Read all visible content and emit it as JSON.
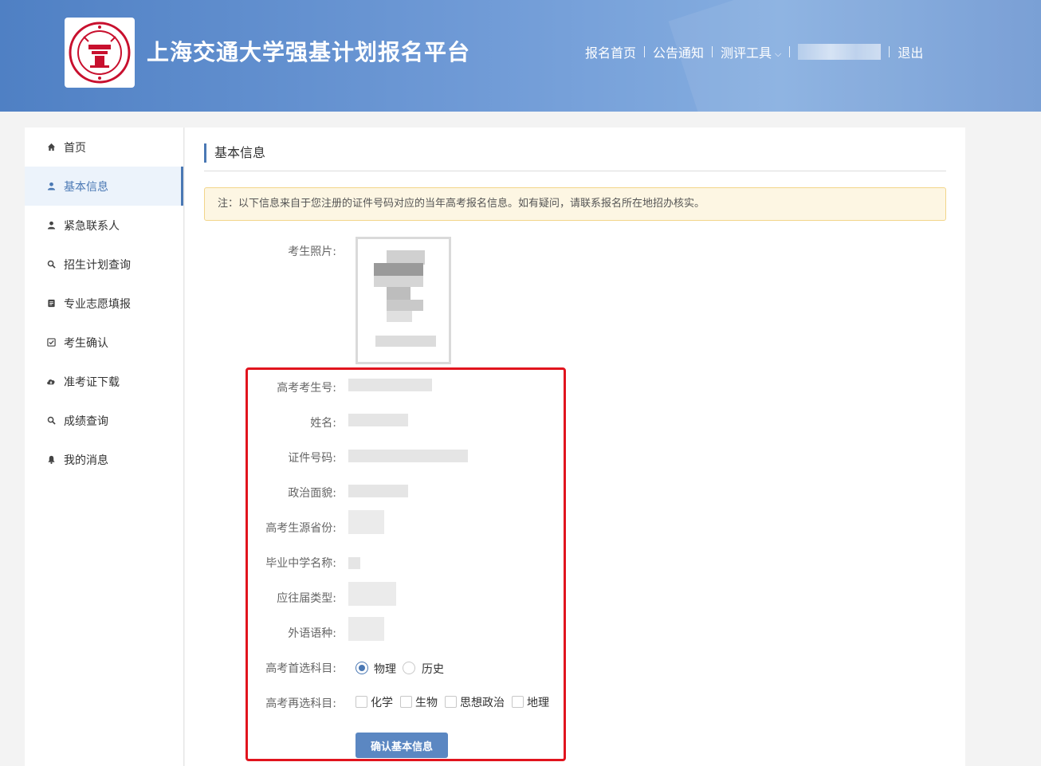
{
  "header": {
    "site_title": "上海交通大学强基计划报名平台",
    "nav": {
      "home": "报名首页",
      "notice": "公告通知",
      "tools": "测评工具",
      "logout": "退出"
    }
  },
  "sidebar": {
    "items": [
      {
        "label": "首页",
        "icon": "home-icon"
      },
      {
        "label": "基本信息",
        "icon": "user-icon"
      },
      {
        "label": "紧急联系人",
        "icon": "user-icon"
      },
      {
        "label": "招生计划查询",
        "icon": "search-icon"
      },
      {
        "label": "专业志愿填报",
        "icon": "form-icon"
      },
      {
        "label": "考生确认",
        "icon": "checkbox-icon"
      },
      {
        "label": "准考证下载",
        "icon": "cloud-download-icon"
      },
      {
        "label": "成绩查询",
        "icon": "search-icon"
      },
      {
        "label": "我的消息",
        "icon": "bell-icon"
      }
    ]
  },
  "main": {
    "section_title": "基本信息",
    "notice": "注：以下信息来自于您注册的证件号码对应的当年高考报名信息。如有疑问，请联系报名所在地招办核实。",
    "labels": {
      "photo": "考生照片:",
      "exam_no": "高考考生号:",
      "name": "姓名:",
      "id_no": "证件号码:",
      "political": "政治面貌:",
      "province": "高考生源省份:",
      "school": "毕业中学名称:",
      "grad_type": "应往届类型:",
      "language": "外语语种:",
      "first_subject": "高考首选科目:",
      "second_subject": "高考再选科目:"
    },
    "first_subject_options": [
      {
        "label": "物理",
        "checked": true
      },
      {
        "label": "历史",
        "checked": false
      }
    ],
    "second_subject_options": [
      {
        "label": "化学",
        "checked": false
      },
      {
        "label": "生物",
        "checked": false
      },
      {
        "label": "思想政治",
        "checked": false
      },
      {
        "label": "地理",
        "checked": false
      }
    ],
    "confirm_button": "确认基本信息"
  },
  "colors": {
    "accent": "#4a78b4",
    "highlight": "#e1141e",
    "notice_bg": "#fdf6e3"
  }
}
